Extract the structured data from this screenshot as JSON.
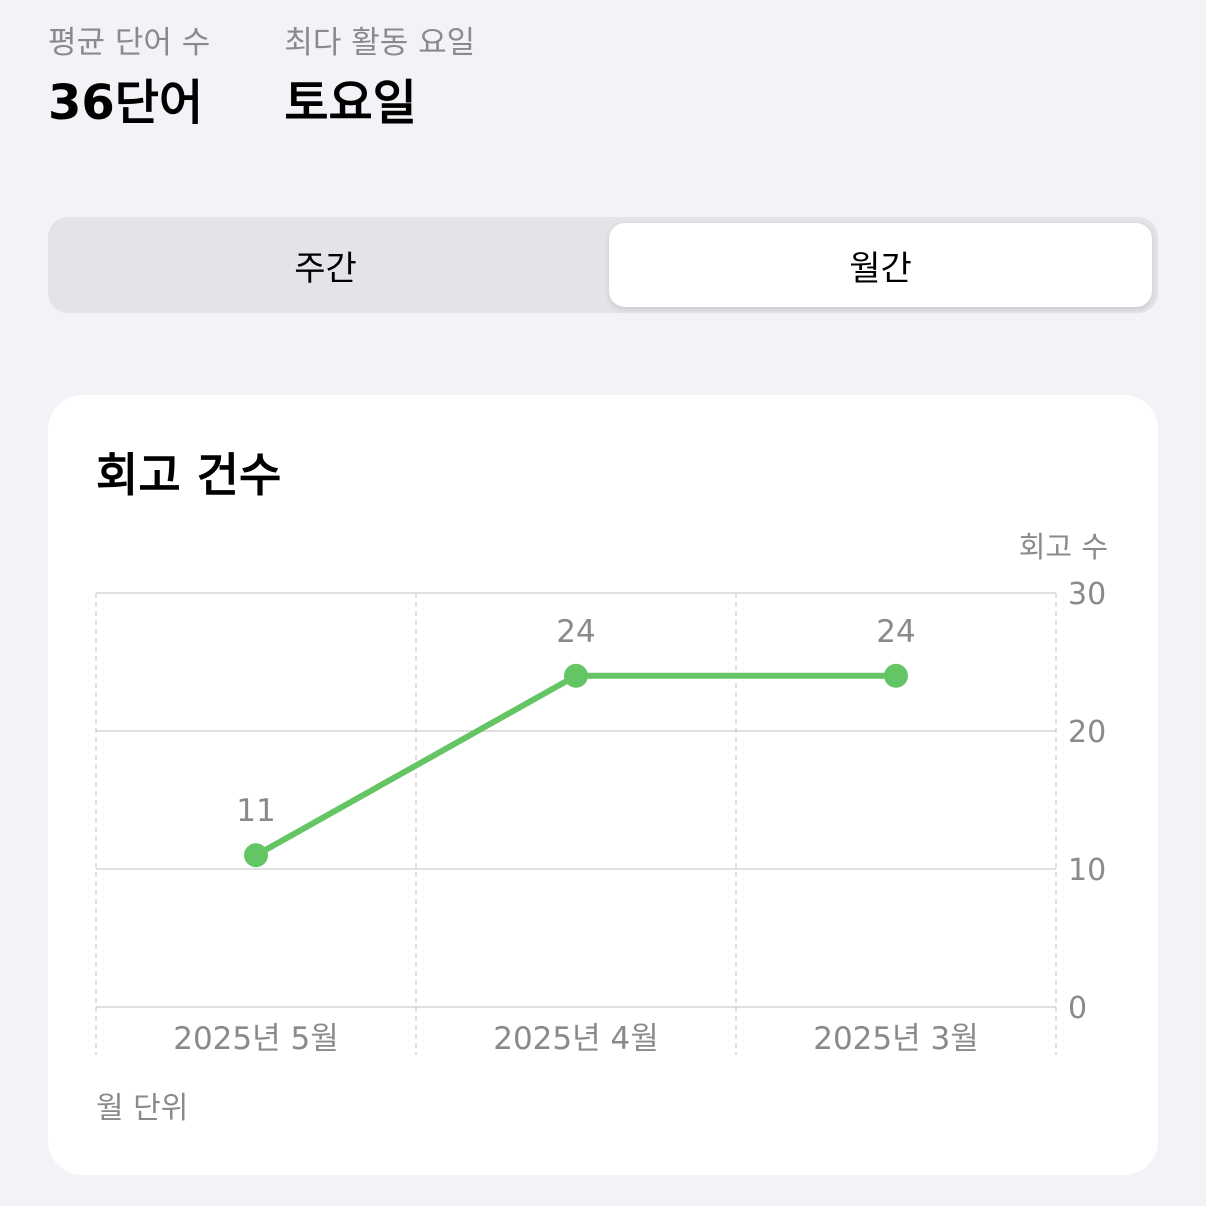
{
  "stats": {
    "avg_words_label": "평균 단어 수",
    "avg_words_value": "36단어",
    "top_day_label": "최다 활동 요일",
    "top_day_value": "토요일"
  },
  "segmented": {
    "weekly_label": "주간",
    "monthly_label": "월간",
    "selected": "monthly"
  },
  "card": {
    "title": "회고 건수",
    "unit_label": "월 단위"
  },
  "colors": {
    "line": "#63c564",
    "grid": "#d6d6d6",
    "tick_text": "#8a8a8e"
  },
  "chart_data": {
    "type": "line",
    "title": "회고 건수",
    "ylabel": "회고 수",
    "xlabel": "월 단위",
    "categories": [
      "2025년 5월",
      "2025년 4월",
      "2025년 3월"
    ],
    "series": [
      {
        "values": [
          11,
          24,
          24
        ]
      }
    ],
    "ylim": [
      0,
      30
    ],
    "yticks": [
      0,
      10,
      20,
      30
    ],
    "y_axis_side": "right",
    "grid": true,
    "data_labels": true
  }
}
